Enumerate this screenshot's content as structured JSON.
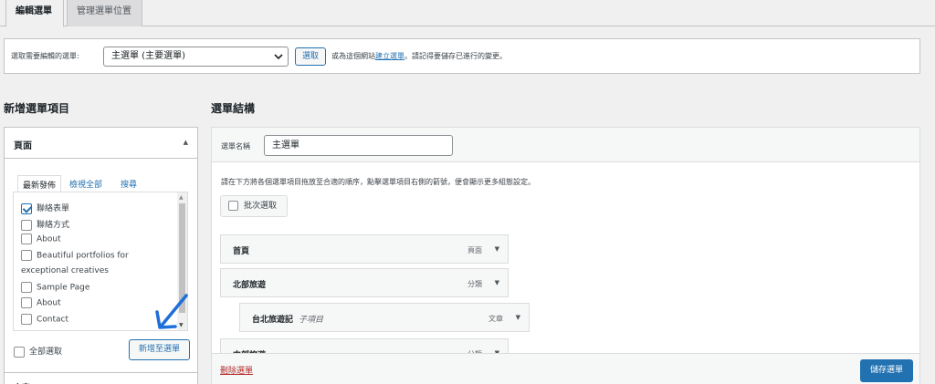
{
  "tabs": {
    "edit": "編輯選單",
    "manage": "管理選單位置"
  },
  "menu_bar": {
    "label": "選取需要編輯的選單:",
    "selected_menu": "主選單 (主要選單)",
    "select_button": "選取",
    "note_prefix": "或為這個網站",
    "create_link": "建立選單",
    "note_suffix": "。請記得要儲存已進行的變更。"
  },
  "add_items": {
    "heading": "新增選單項目",
    "section_title": "頁面",
    "subtabs": {
      "recent": "最新發佈",
      "view_all": "檢視全部",
      "search": "搜尋"
    },
    "items": [
      {
        "label": "聯絡表單",
        "checked": true
      },
      {
        "label": "聯絡方式",
        "checked": false
      },
      {
        "label": "About",
        "checked": false
      },
      {
        "label": "Beautiful portfolios for",
        "checked": false
      },
      {
        "label": "exceptional creatives",
        "checked": false
      },
      {
        "label": "Sample Page",
        "checked": false
      },
      {
        "label": "About",
        "checked": false
      },
      {
        "label": "Contact",
        "checked": false
      }
    ],
    "select_all": "全部選取",
    "add_button": "新增至選單",
    "next_section": "文章"
  },
  "structure": {
    "heading": "選單結構",
    "name_label": "選單名稱",
    "name_value": "主選單",
    "instructions": "請在下方將各個選單項目拖放至合適的順序，點擊選單項目右側的箭號，便會顯示更多組態設定。",
    "bulk_select": "批次選取",
    "menu_items": [
      {
        "title": "首頁",
        "type": "頁面",
        "subtitle": ""
      },
      {
        "title": "北部旅遊",
        "type": "分類",
        "subtitle": ""
      },
      {
        "title": "台北旅遊記",
        "type": "文章",
        "subtitle": "子項目"
      },
      {
        "title": "中部旅遊",
        "type": "分類",
        "subtitle": ""
      }
    ],
    "delete_link": "刪除選單",
    "save_button": "儲存選單"
  },
  "colors": {
    "accent": "#2271b1",
    "danger": "#b32d2e",
    "annotation_arrow": "#1e6fd9"
  }
}
